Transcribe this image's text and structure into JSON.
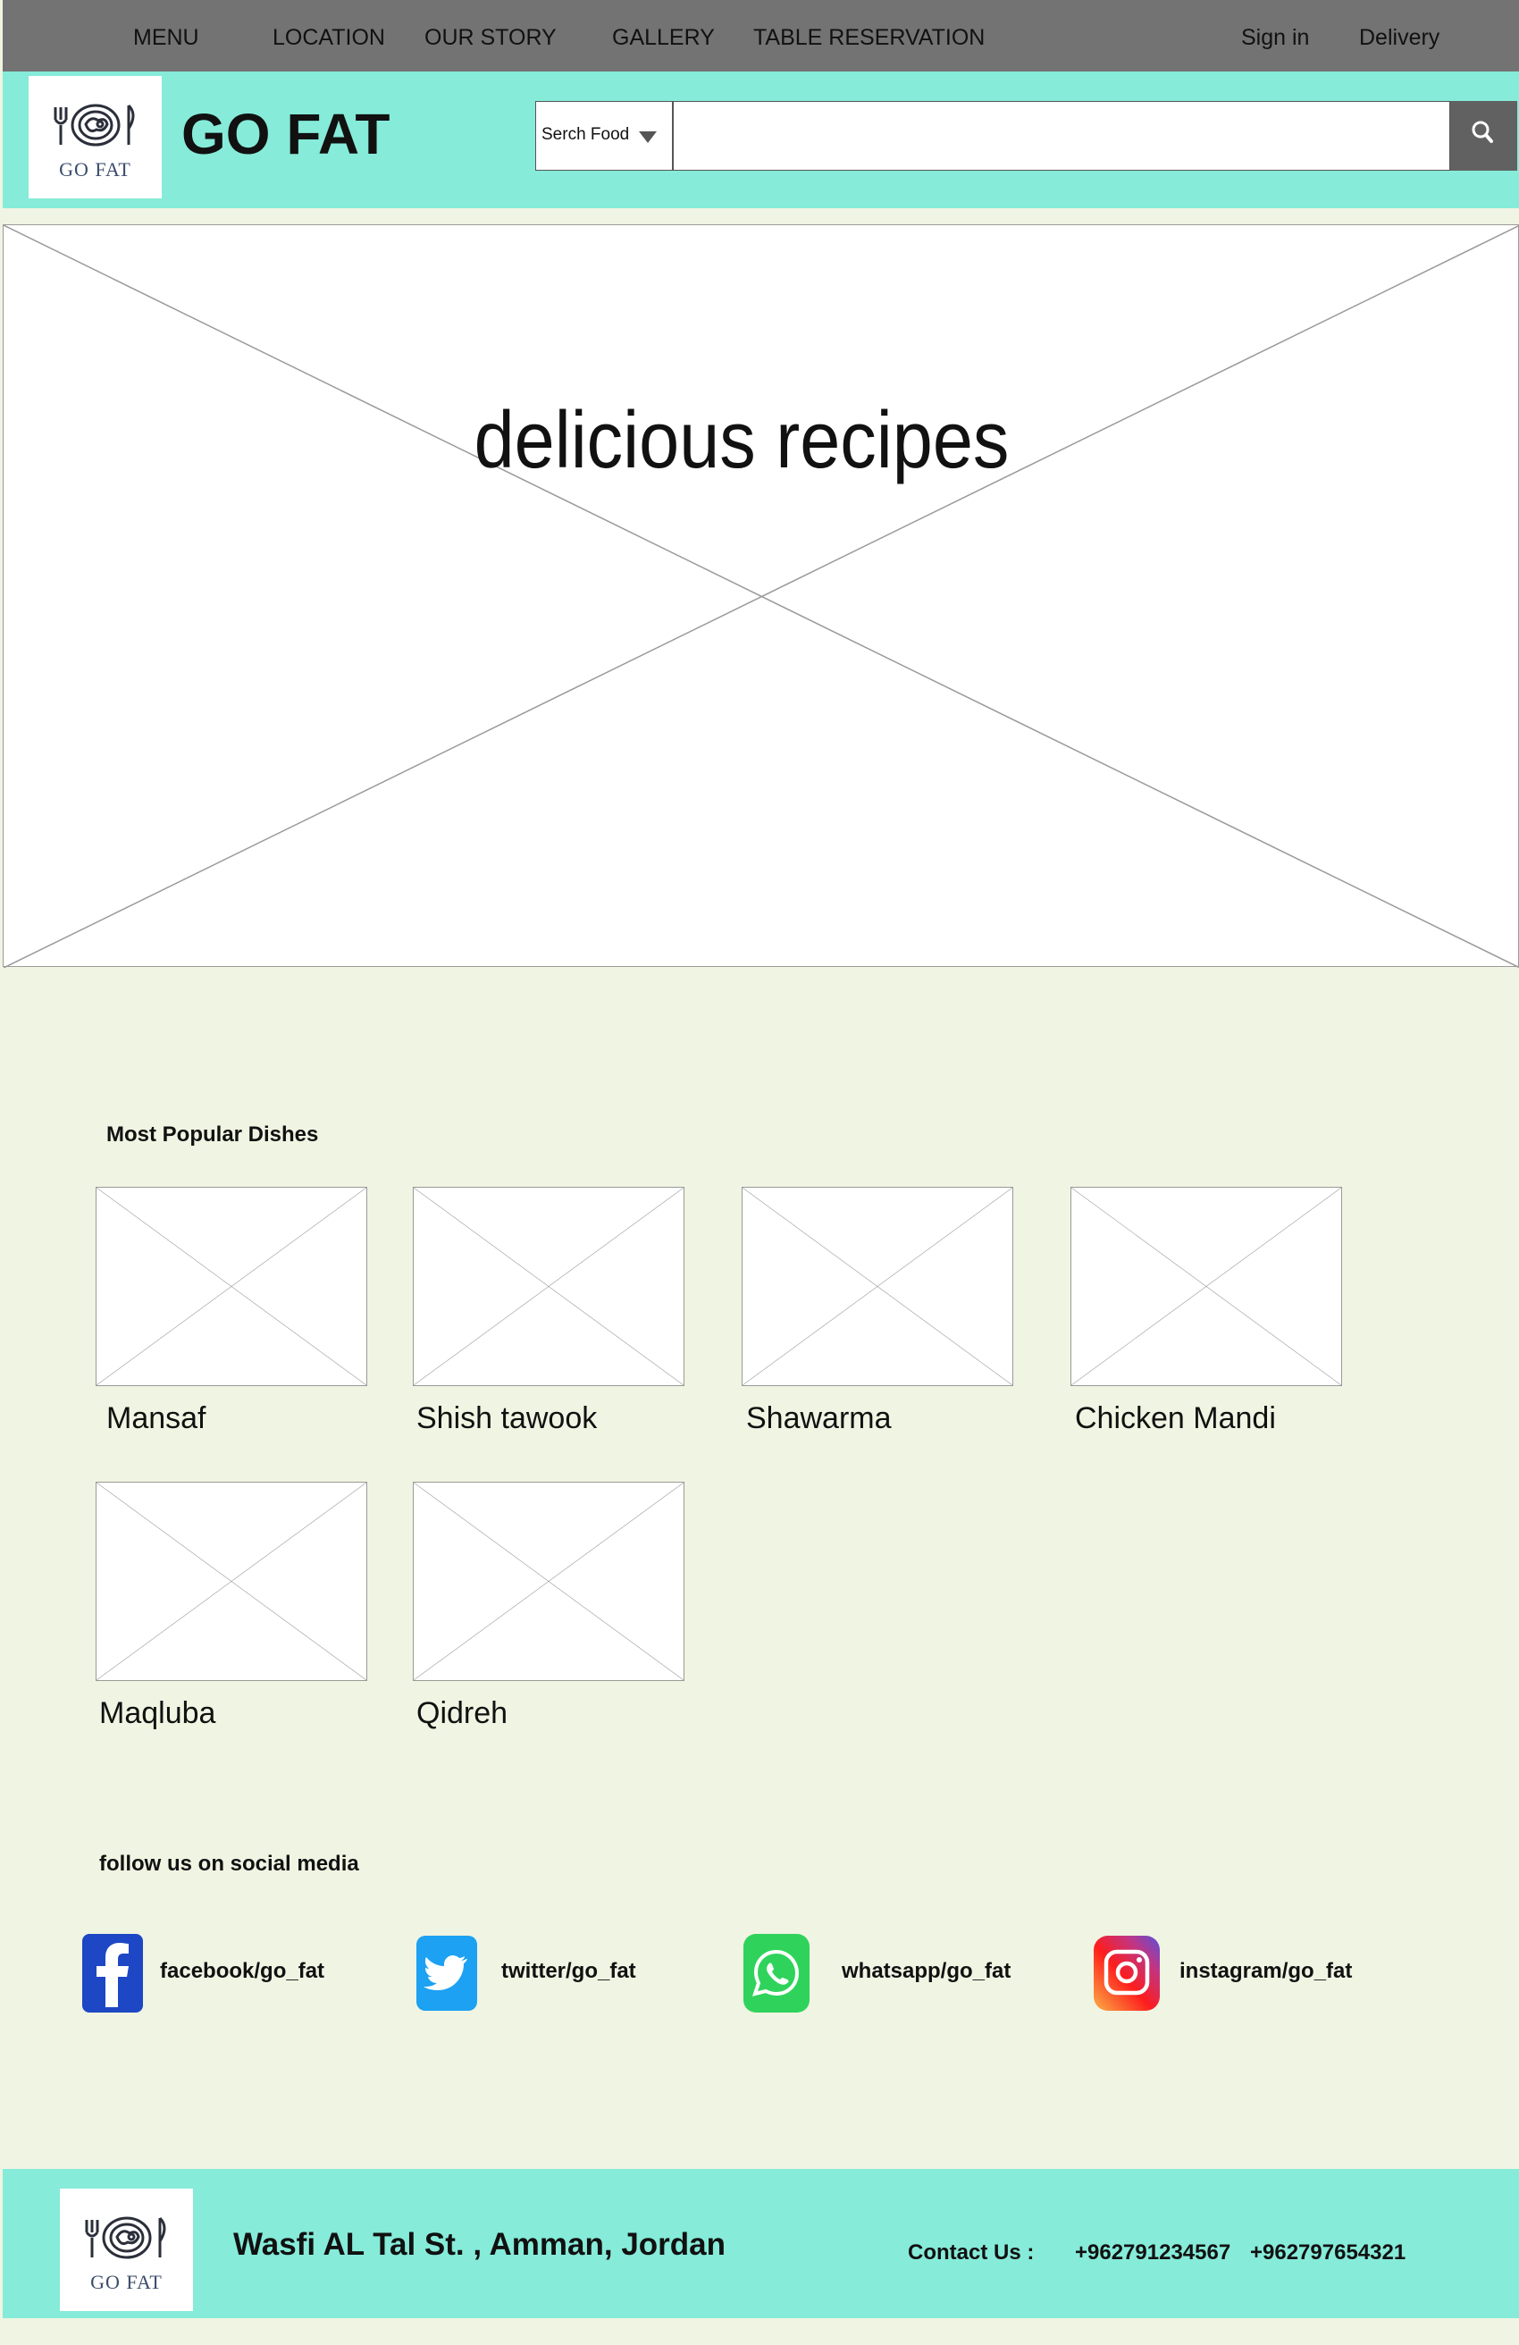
{
  "nav": {
    "menu": "MENU",
    "location": "LOCATION",
    "our_story": "OUR STORY",
    "gallery": "GALLERY",
    "table_reservation": "TABLE RESERVATION",
    "sign_in": "Sign in",
    "delivery": "Delivery"
  },
  "header": {
    "logo_text": "GO FAT",
    "brand": "GO FAT",
    "search_category": "Serch Food",
    "search_value": ""
  },
  "hero": {
    "title": "delicious recipes"
  },
  "popular": {
    "title": "Most Popular Dishes",
    "dishes": [
      "Mansaf",
      "Shish tawook",
      "Shawarma",
      "Chicken Mandi",
      "Maqluba",
      "Qidreh"
    ]
  },
  "social": {
    "title": "follow us on social media",
    "items": [
      {
        "label": "facebook/go_fat",
        "icon": "facebook-icon"
      },
      {
        "label": "twitter/go_fat",
        "icon": "twitter-icon"
      },
      {
        "label": "whatsapp/go_fat",
        "icon": "whatsapp-icon"
      },
      {
        "label": "instagram/go_fat",
        "icon": "instagram-icon"
      }
    ]
  },
  "footer": {
    "logo_text": "GO FAT",
    "address": "Wasfi AL Tal St. , Amman, Jordan",
    "contact_label": "Contact Us :",
    "phone1": "+962791234567",
    "phone2": "+962797654321"
  },
  "colors": {
    "nav_bg": "#737373",
    "header_bg": "#86ebd9",
    "page_bg": "#f0f4e2",
    "search_button": "#616161"
  }
}
